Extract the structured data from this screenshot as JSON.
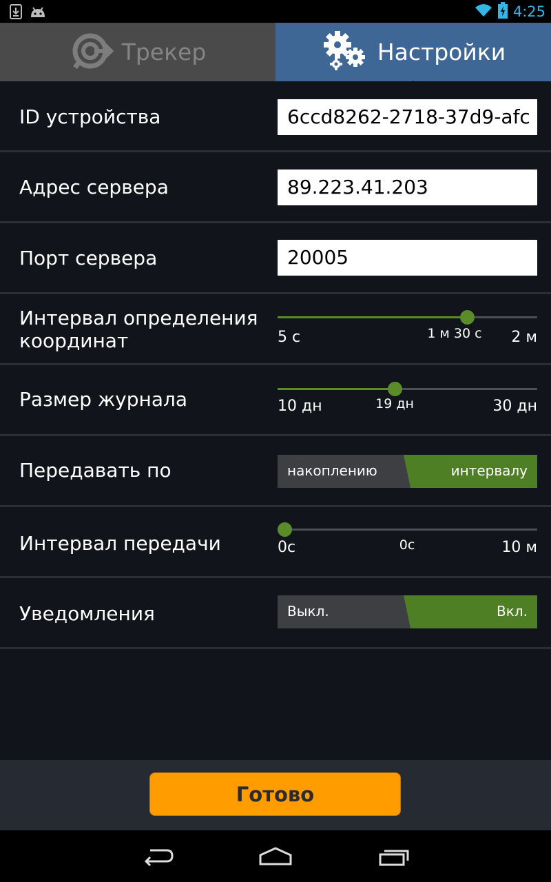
{
  "status_bar": {
    "time": "4:25",
    "icons": [
      "download-icon",
      "android-icon",
      "wifi-icon",
      "battery-charging-icon"
    ]
  },
  "tabs": [
    {
      "label": "Трекер",
      "icon": "tracker-icon",
      "active": false
    },
    {
      "label": "Настройки",
      "icon": "gears-icon",
      "active": true
    }
  ],
  "settings": {
    "device_id": {
      "label": "ID устройства",
      "value": "6ccd8262-2718-37d9-afc"
    },
    "server_address": {
      "label": "Адрес сервера",
      "value": "89.223.41.203"
    },
    "server_port": {
      "label": "Порт сервера",
      "value": "20005"
    },
    "location_interval": {
      "label_line1": "Интервал определения",
      "label_line2": "координат",
      "min": "5 с",
      "current": "1 м 30 с",
      "max": "2 м",
      "fraction": 0.73
    },
    "log_size": {
      "label": "Размер журнала",
      "min": "10 дн",
      "current": "19 дн",
      "max": "30 дн",
      "fraction": 0.45
    },
    "send_by": {
      "label": "Передавать по",
      "option_off": "накоплению",
      "option_on": "интервалу",
      "selected": "интервалу"
    },
    "send_interval": {
      "label": "Интервал передачи",
      "min": "0с",
      "current": "0с",
      "max": "10 м",
      "fraction": 0.0
    },
    "notifications": {
      "label": "Уведомления",
      "option_off": "Выкл.",
      "option_on": "Вкл.",
      "selected": "Вкл."
    }
  },
  "done_button": {
    "label": "Готово"
  },
  "nav": {
    "icons": [
      "back-icon",
      "home-icon",
      "recent-apps-icon"
    ]
  },
  "colors": {
    "accent_green": "#5a8c2a",
    "tab_active": "#3e6796",
    "button_orange": "#ff9c00",
    "status_blue": "#33b5e5"
  }
}
